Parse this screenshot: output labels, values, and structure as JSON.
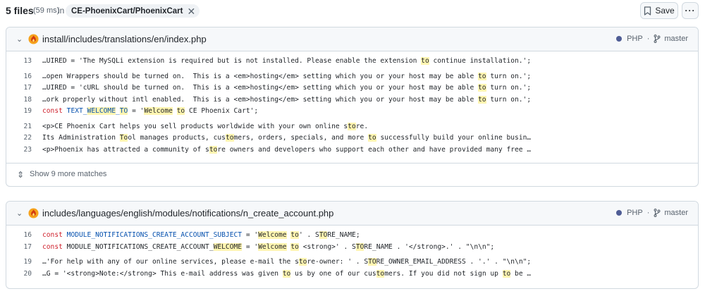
{
  "header": {
    "count": "5 files",
    "time": "(59 ms)",
    "in_label": "in",
    "repo": "CE-PhoenixCart/PhoenixCart",
    "remove_icon": "close-icon",
    "save_label": "Save",
    "save_icon": "bookmark-icon",
    "more_icon": "kebab-horizontal-icon",
    "more_glyph": "···"
  },
  "colors": {
    "highlight": "#fff5b1",
    "php_dot": "#4f5d95",
    "keyword": "#cf222e",
    "constant": "#0550ae"
  },
  "results": [
    {
      "path": "install/includes/translations/en/index.php",
      "lang": "PHP",
      "branch": "master",
      "more_matches": "Show 9 more matches",
      "lines": [
        {
          "n": "13",
          "segs": [
            [
              "…UIRED = 'The MySQLi extension is required but is not installed. Please enable the extension ",
              ""
            ],
            [
              "to",
              "hl"
            ],
            [
              " continue installation.';",
              ""
            ]
          ]
        },
        {
          "gap": true
        },
        {
          "n": "16",
          "segs": [
            [
              "…open Wrappers should be turned on.  This is a <em>hosting</em> setting which you or your host may be able ",
              ""
            ],
            [
              "to",
              "hl"
            ],
            [
              " turn on.';",
              ""
            ]
          ]
        },
        {
          "n": "17",
          "segs": [
            [
              "…UIRED = 'cURL should be turned on.  This is a <em>hosting</em> setting which you or your host may be able ",
              ""
            ],
            [
              "to",
              "hl"
            ],
            [
              " turn on.';",
              ""
            ]
          ]
        },
        {
          "n": "18",
          "segs": [
            [
              "…ork properly without intl enabled.  This is a <em>hosting</em> setting which you or your host may be able ",
              ""
            ],
            [
              "to",
              "hl"
            ],
            [
              " turn on.';",
              ""
            ]
          ]
        },
        {
          "n": "19",
          "segs": [
            [
              "const",
              "kw"
            ],
            [
              " TEXT_",
              "cn"
            ],
            [
              "WELCOME",
              "cn hl"
            ],
            [
              "_",
              "cn"
            ],
            [
              "TO",
              "cn hl"
            ],
            [
              " = '",
              ""
            ],
            [
              "Welcome",
              "hl"
            ],
            [
              " ",
              ""
            ],
            [
              "to",
              "hl"
            ],
            [
              " CE Phoenix Cart';",
              ""
            ]
          ]
        },
        {
          "gap": true
        },
        {
          "n": "21",
          "segs": [
            [
              "<p>CE Phoenix Cart helps you sell products worldwide with your own online s",
              ""
            ],
            [
              "to",
              "hl"
            ],
            [
              "re.",
              ""
            ]
          ]
        },
        {
          "n": "22",
          "segs": [
            [
              "Its Administration ",
              ""
            ],
            [
              "To",
              "hl"
            ],
            [
              "ol manages products, cus",
              ""
            ],
            [
              "to",
              "hl"
            ],
            [
              "mers, orders, specials, and more ",
              ""
            ],
            [
              "to",
              "hl"
            ],
            [
              " successfully build your online busin…",
              ""
            ]
          ]
        },
        {
          "n": "23",
          "segs": [
            [
              "<p>Phoenix has attracted a community of s",
              ""
            ],
            [
              "to",
              "hl"
            ],
            [
              "re owners and developers who support each other and have provided many free …",
              ""
            ]
          ]
        }
      ]
    },
    {
      "path": "includes/languages/english/modules/notifications/n_create_account.php",
      "lang": "PHP",
      "branch": "master",
      "lines": [
        {
          "n": "16",
          "segs": [
            [
              "const",
              "kw"
            ],
            [
              " MODULE_NOTIFICATIONS_CREATE_ACCOUNT_SUBJECT",
              "cn"
            ],
            [
              " = '",
              ""
            ],
            [
              "Welcome",
              "hl"
            ],
            [
              " ",
              ""
            ],
            [
              "to",
              "hl"
            ],
            [
              "' . S",
              ""
            ],
            [
              "TO",
              "hl"
            ],
            [
              "RE_NAME;",
              ""
            ]
          ]
        },
        {
          "n": "17",
          "segs": [
            [
              "const",
              "kw"
            ],
            [
              " MODULE_NOTIFICATIONS_CREATE_ACCOUNT_",
              ""
            ],
            [
              "WELCOME",
              "hl"
            ],
            [
              " = '",
              ""
            ],
            [
              "Welcome",
              "hl"
            ],
            [
              " ",
              ""
            ],
            [
              "to",
              "hl"
            ],
            [
              " <strong>' . S",
              ""
            ],
            [
              "TO",
              "hl"
            ],
            [
              "RE_NAME . '</strong>.' . \"\\n\\n\";",
              ""
            ]
          ]
        },
        {
          "gap": true
        },
        {
          "n": "19",
          "segs": [
            [
              "…'For help with any of our online services, please e-mail the s",
              ""
            ],
            [
              "to",
              "hl"
            ],
            [
              "re-owner: ' . S",
              ""
            ],
            [
              "TO",
              "hl"
            ],
            [
              "RE_OWNER_EMAIL_ADDRESS . '.' . \"\\n\\n\";",
              ""
            ]
          ]
        },
        {
          "n": "20",
          "segs": [
            [
              "…G = '<strong>Note:</strong> This e-mail address was given ",
              ""
            ],
            [
              "to",
              "hl"
            ],
            [
              " us by one of our cus",
              ""
            ],
            [
              "to",
              "hl"
            ],
            [
              "mers. If you did not sign up ",
              ""
            ],
            [
              "to",
              "hl"
            ],
            [
              " be …",
              ""
            ]
          ]
        }
      ]
    }
  ]
}
